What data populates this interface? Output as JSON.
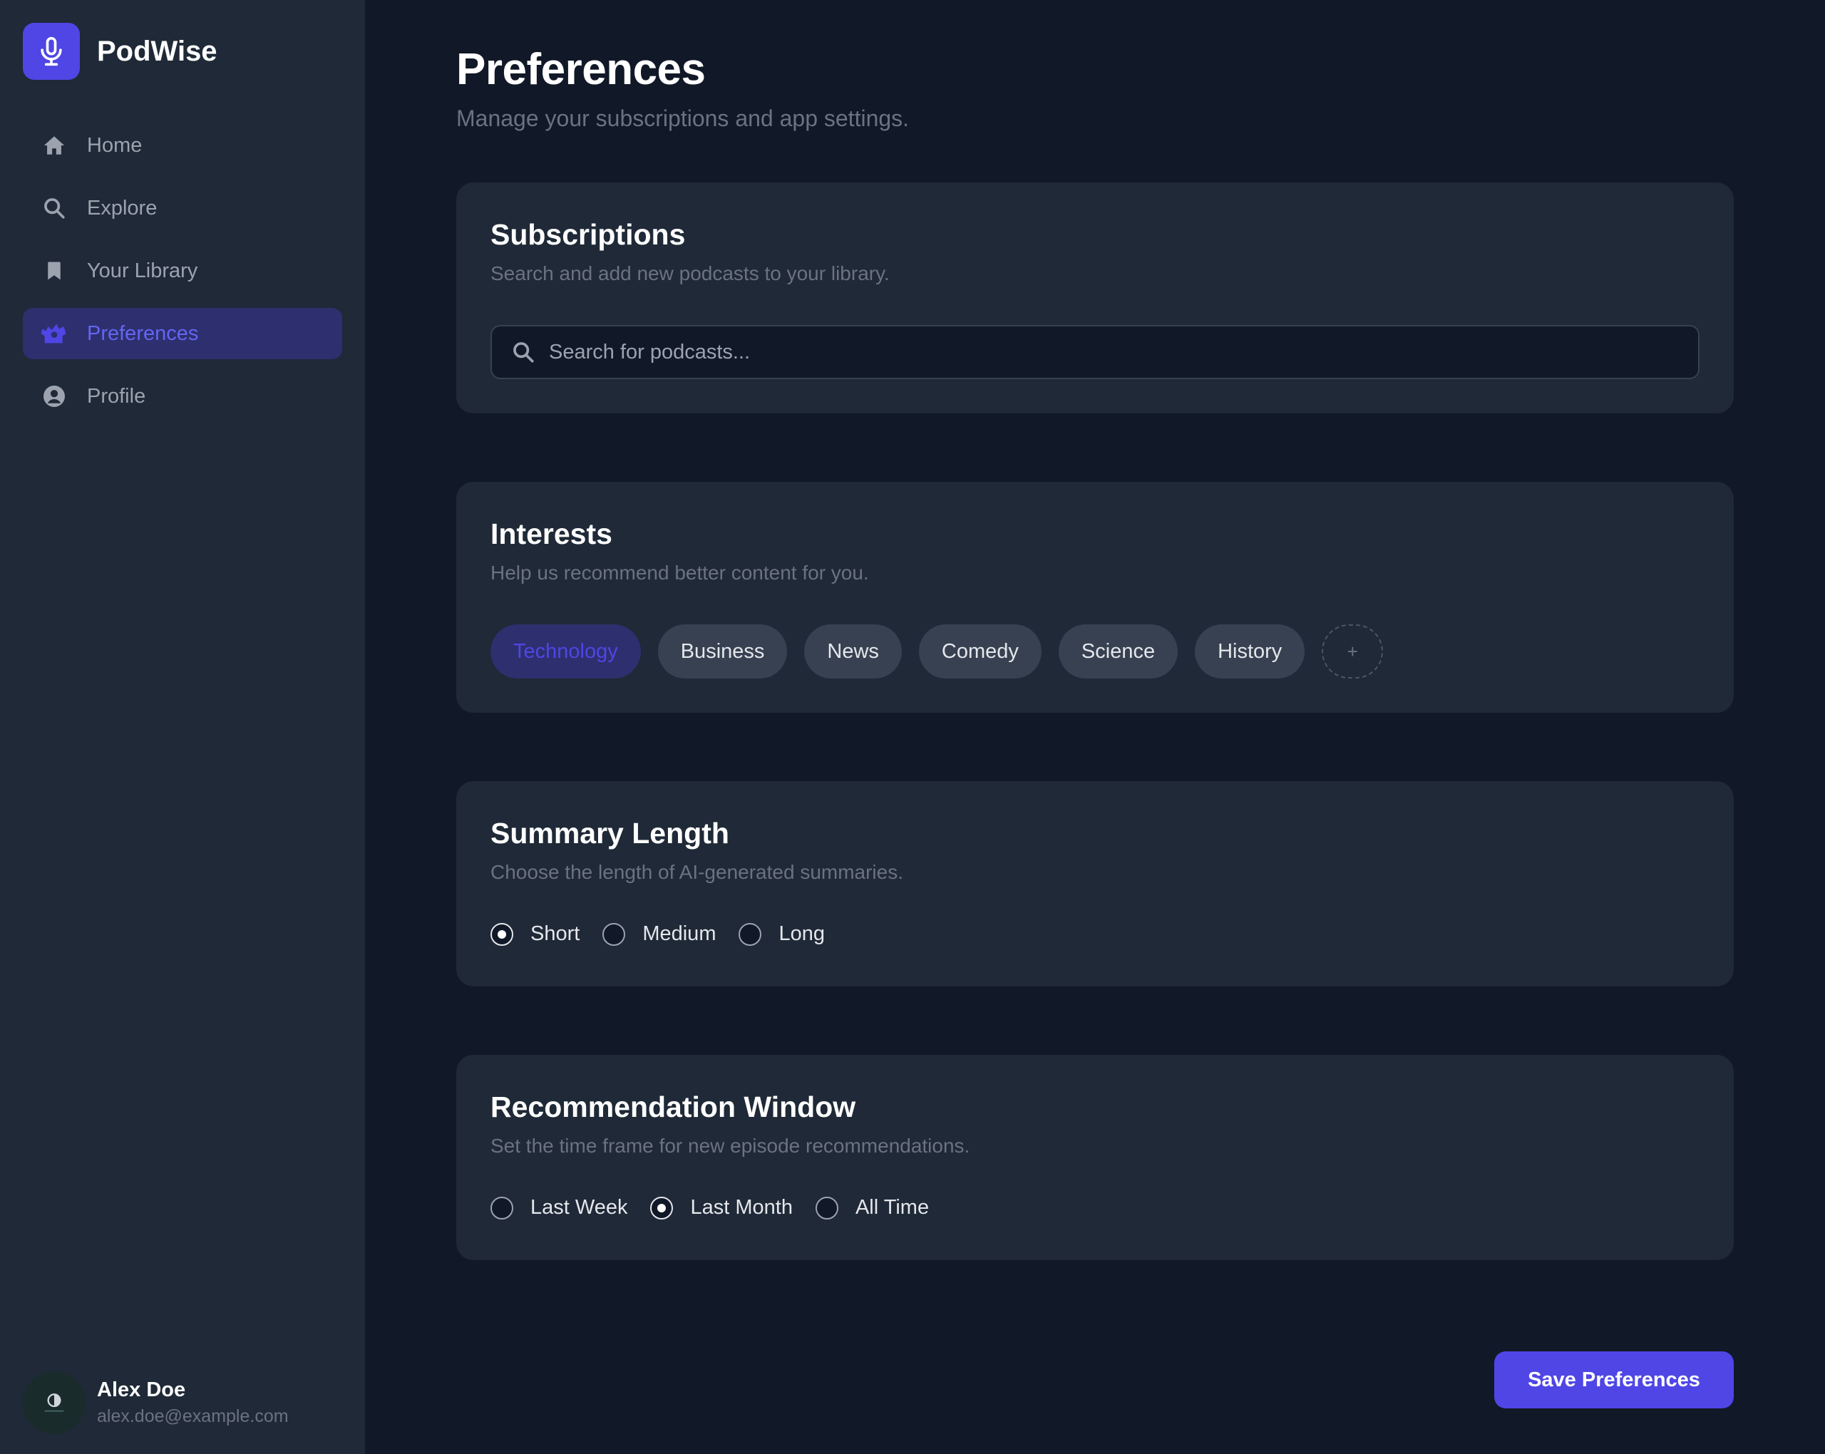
{
  "brand": {
    "name": "PodWise",
    "icon": "microphone-icon"
  },
  "nav": {
    "items": [
      {
        "label": "Home",
        "icon": "home-icon"
      },
      {
        "label": "Explore",
        "icon": "search-icon"
      },
      {
        "label": "Your Library",
        "icon": "bookmark-icon"
      },
      {
        "label": "Preferences",
        "icon": "preferences-icon",
        "active": true
      },
      {
        "label": "Profile",
        "icon": "user-circle-icon"
      }
    ]
  },
  "user": {
    "name": "Alex Doe",
    "email": "alex.doe@example.com"
  },
  "page": {
    "title": "Preferences",
    "subtitle": "Manage your subscriptions and app settings."
  },
  "subscriptions": {
    "title": "Subscriptions",
    "subtitle": "Search and add new podcasts to your library.",
    "search_placeholder": "Search for podcasts...",
    "search_value": ""
  },
  "interests": {
    "title": "Interests",
    "subtitle": "Help us recommend better content for you.",
    "tags": [
      {
        "label": "Technology",
        "selected": true
      },
      {
        "label": "Business",
        "selected": false
      },
      {
        "label": "News",
        "selected": false
      },
      {
        "label": "Comedy",
        "selected": false
      },
      {
        "label": "Science",
        "selected": false
      },
      {
        "label": "History",
        "selected": false
      }
    ],
    "add_label": "+"
  },
  "summary_length": {
    "title": "Summary Length",
    "subtitle": "Choose the length of AI-generated summaries.",
    "options": [
      "Short",
      "Medium",
      "Long"
    ],
    "selected": "Short"
  },
  "recommendation_window": {
    "title": "Recommendation Window",
    "subtitle": "Set the time frame for new episode recommendations.",
    "options": [
      "Last Week",
      "Last Month",
      "All Time"
    ],
    "selected": "Last Month"
  },
  "save_label": "Save Preferences",
  "colors": {
    "accent": "#4f46e5",
    "background": "#111827",
    "panel": "#1f2937"
  }
}
